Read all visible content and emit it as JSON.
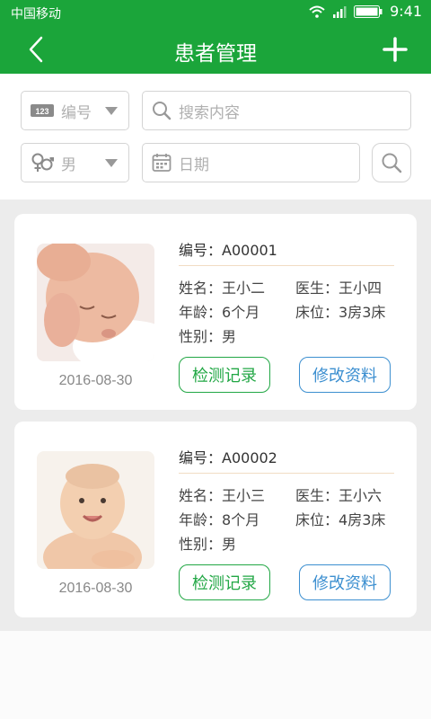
{
  "status_bar": {
    "carrier": "中国移动",
    "time": "9:41"
  },
  "nav": {
    "title": "患者管理"
  },
  "filters": {
    "id_select": "编号",
    "search_placeholder": "搜索内容",
    "gender_select": "男",
    "date_placeholder": "日期"
  },
  "patients": [
    {
      "code_label": "编号：",
      "code": "A00001",
      "name_label": "姓名：",
      "name": "王小二",
      "doctor_label": "医生：",
      "doctor": "王小四",
      "age_label": "年龄：",
      "age": "6个月",
      "bed_label": "床位：",
      "bed": "3房3床",
      "gender_label": "性别：",
      "gender": "男",
      "date": "2016-08-30",
      "btn_record": "检测记录",
      "btn_edit": "修改资料"
    },
    {
      "code_label": "编号：",
      "code": "A00002",
      "name_label": "姓名：",
      "name": "王小三",
      "doctor_label": "医生：",
      "doctor": "王小六",
      "age_label": "年龄：",
      "age": "8个月",
      "bed_label": "床位：",
      "bed": "4房3床",
      "gender_label": "性别：",
      "gender": "男",
      "date": "2016-08-30",
      "btn_record": "检测记录",
      "btn_edit": "修改资料"
    }
  ],
  "colors": {
    "brand": "#1ba53a",
    "record_button": "#22a745",
    "edit_button": "#3c8fd0",
    "list_bg": "#ececec"
  },
  "icons": [
    "signal-icon",
    "wifi-icon",
    "battery-icon",
    "back-icon",
    "add-icon",
    "number-icon",
    "search-icon",
    "gender-icon",
    "calendar-icon",
    "dropdown-caret-icon",
    "baby-photo-icon"
  ]
}
